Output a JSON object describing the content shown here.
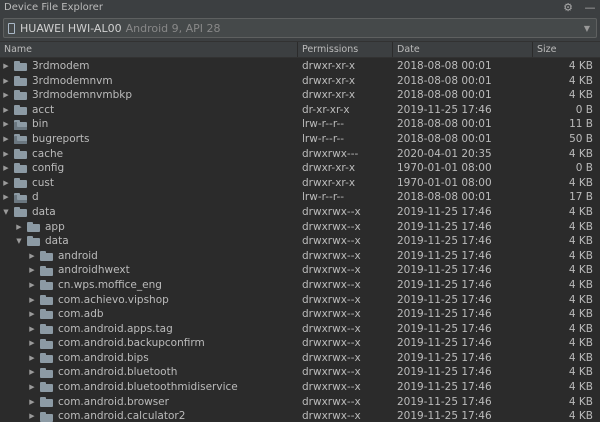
{
  "window": {
    "title": "Device File Explorer"
  },
  "device": {
    "name": "HUAWEI HWI-AL00",
    "detail": "Android 9, API 28"
  },
  "columns": {
    "name": "Name",
    "permissions": "Permissions",
    "date": "Date",
    "size": "Size"
  },
  "icons": {
    "gear": "gear-icon",
    "hide": "hide-panel-icon",
    "device": "phone-icon",
    "folder": "folder-icon",
    "folder_link": "folder-link-icon",
    "expanded": "chevron-down-icon",
    "collapsed": "chevron-right-icon"
  },
  "rows": [
    {
      "name": "3rdmodem",
      "perm": "drwxr-xr-x",
      "date": "2018-08-08 00:01",
      "size": "4 KB",
      "level": 0,
      "expanded": false,
      "link": false
    },
    {
      "name": "3rdmodemnvm",
      "perm": "drwxr-xr-x",
      "date": "2018-08-08 00:01",
      "size": "4 KB",
      "level": 0,
      "expanded": false,
      "link": false
    },
    {
      "name": "3rdmodemnvmbkp",
      "perm": "drwxr-xr-x",
      "date": "2018-08-08 00:01",
      "size": "4 KB",
      "level": 0,
      "expanded": false,
      "link": false
    },
    {
      "name": "acct",
      "perm": "dr-xr-xr-x",
      "date": "2019-11-25 17:46",
      "size": "0 B",
      "level": 0,
      "expanded": false,
      "link": false
    },
    {
      "name": "bin",
      "perm": "lrw-r--r--",
      "date": "2018-08-08 00:01",
      "size": "11 B",
      "level": 0,
      "expanded": false,
      "link": true
    },
    {
      "name": "bugreports",
      "perm": "lrw-r--r--",
      "date": "2018-08-08 00:01",
      "size": "50 B",
      "level": 0,
      "expanded": false,
      "link": true
    },
    {
      "name": "cache",
      "perm": "drwxrwx---",
      "date": "2020-04-01 20:35",
      "size": "4 KB",
      "level": 0,
      "expanded": false,
      "link": false
    },
    {
      "name": "config",
      "perm": "drwxr-xr-x",
      "date": "1970-01-01 08:00",
      "size": "0 B",
      "level": 0,
      "expanded": false,
      "link": false
    },
    {
      "name": "cust",
      "perm": "drwxr-xr-x",
      "date": "1970-01-01 08:00",
      "size": "4 KB",
      "level": 0,
      "expanded": false,
      "link": false
    },
    {
      "name": "d",
      "perm": "lrw-r--r--",
      "date": "2018-08-08 00:01",
      "size": "17 B",
      "level": 0,
      "expanded": false,
      "link": true
    },
    {
      "name": "data",
      "perm": "drwxrwx--x",
      "date": "2019-11-25 17:46",
      "size": "4 KB",
      "level": 0,
      "expanded": true,
      "link": false
    },
    {
      "name": "app",
      "perm": "drwxrwx--x",
      "date": "2019-11-25 17:46",
      "size": "4 KB",
      "level": 1,
      "expanded": false,
      "link": false
    },
    {
      "name": "data",
      "perm": "drwxrwx--x",
      "date": "2019-11-25 17:46",
      "size": "4 KB",
      "level": 1,
      "expanded": true,
      "link": false
    },
    {
      "name": "android",
      "perm": "drwxrwx--x",
      "date": "2019-11-25 17:46",
      "size": "4 KB",
      "level": 2,
      "expanded": false,
      "link": false
    },
    {
      "name": "androidhwext",
      "perm": "drwxrwx--x",
      "date": "2019-11-25 17:46",
      "size": "4 KB",
      "level": 2,
      "expanded": false,
      "link": false
    },
    {
      "name": "cn.wps.moffice_eng",
      "perm": "drwxrwx--x",
      "date": "2019-11-25 17:46",
      "size": "4 KB",
      "level": 2,
      "expanded": false,
      "link": false
    },
    {
      "name": "com.achievo.vipshop",
      "perm": "drwxrwx--x",
      "date": "2019-11-25 17:46",
      "size": "4 KB",
      "level": 2,
      "expanded": false,
      "link": false
    },
    {
      "name": "com.adb",
      "perm": "drwxrwx--x",
      "date": "2019-11-25 17:46",
      "size": "4 KB",
      "level": 2,
      "expanded": false,
      "link": false
    },
    {
      "name": "com.android.apps.tag",
      "perm": "drwxrwx--x",
      "date": "2019-11-25 17:46",
      "size": "4 KB",
      "level": 2,
      "expanded": false,
      "link": false
    },
    {
      "name": "com.android.backupconfirm",
      "perm": "drwxrwx--x",
      "date": "2019-11-25 17:46",
      "size": "4 KB",
      "level": 2,
      "expanded": false,
      "link": false
    },
    {
      "name": "com.android.bips",
      "perm": "drwxrwx--x",
      "date": "2019-11-25 17:46",
      "size": "4 KB",
      "level": 2,
      "expanded": false,
      "link": false
    },
    {
      "name": "com.android.bluetooth",
      "perm": "drwxrwx--x",
      "date": "2019-11-25 17:46",
      "size": "4 KB",
      "level": 2,
      "expanded": false,
      "link": false
    },
    {
      "name": "com.android.bluetoothmidiservice",
      "perm": "drwxrwx--x",
      "date": "2019-11-25 17:46",
      "size": "4 KB",
      "level": 2,
      "expanded": false,
      "link": false
    },
    {
      "name": "com.android.browser",
      "perm": "drwxrwx--x",
      "date": "2019-11-25 17:46",
      "size": "4 KB",
      "level": 2,
      "expanded": false,
      "link": false
    },
    {
      "name": "com.android.calculator2",
      "perm": "drwxrwx--x",
      "date": "2019-11-25 17:46",
      "size": "4 KB",
      "level": 2,
      "expanded": false,
      "link": false
    }
  ]
}
